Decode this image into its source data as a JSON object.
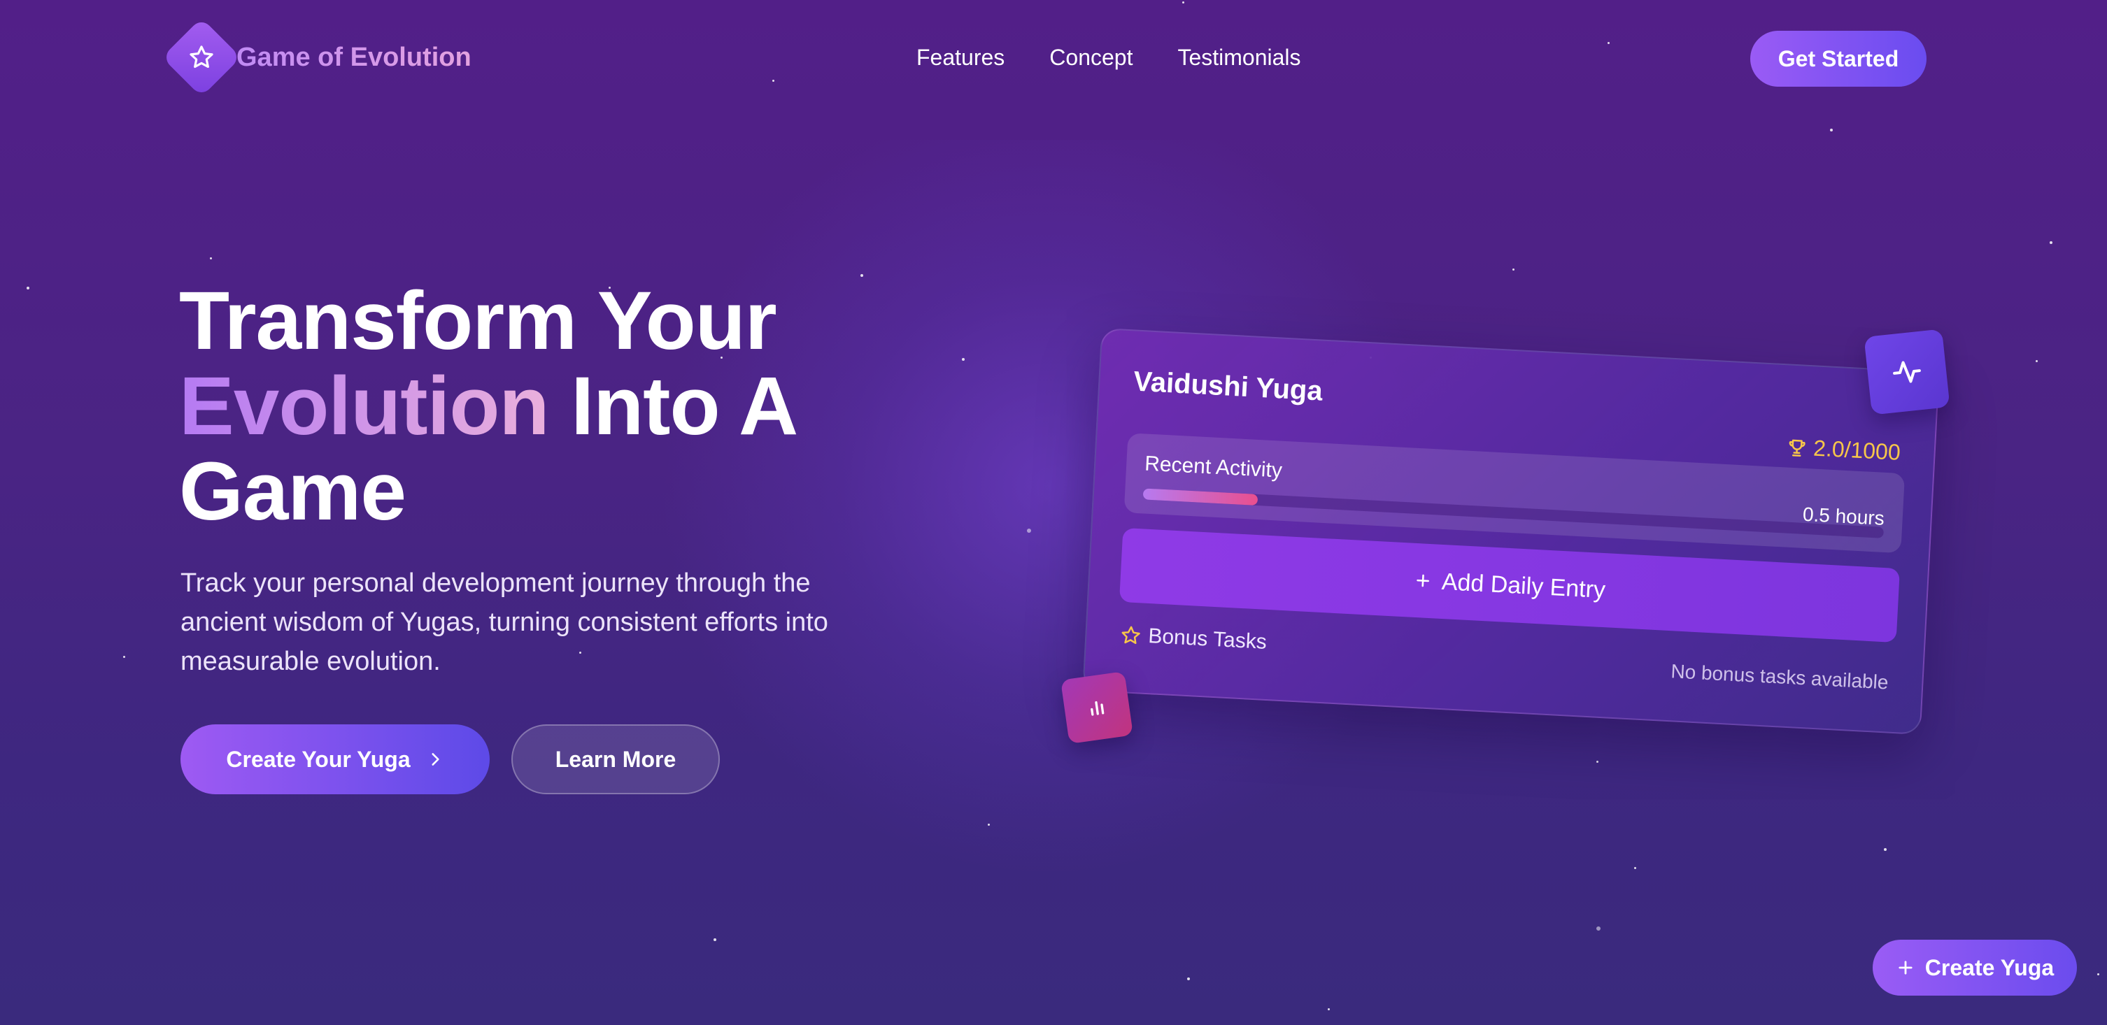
{
  "brand": {
    "name": "Game of Evolution",
    "logo_icon": "star-icon"
  },
  "nav": {
    "links": [
      {
        "label": "Features"
      },
      {
        "label": "Concept"
      },
      {
        "label": "Testimonials"
      }
    ],
    "cta_label": "Get Started"
  },
  "hero": {
    "title_line1": "Transform Your",
    "title_highlight": "Evolution",
    "title_line2_rest": " Into A",
    "title_line3": "Game",
    "description": "Track your personal development journey through the ancient wisdom of Yugas, turning consistent efforts into measurable evolution.",
    "primary_button": "Create Your Yuga",
    "secondary_button": "Learn More"
  },
  "card": {
    "title": "Vaidushi Yuga",
    "score": "2.0/1000",
    "recent_activity_label": "Recent Activity",
    "recent_activity_value": "0.5 hours",
    "progress_fraction": 0.155,
    "add_entry_label": "Add Daily Entry",
    "bonus_label": "Bonus Tasks",
    "bonus_empty": "No bonus tasks available"
  },
  "floating_button": {
    "label": "Create Yuga"
  },
  "colors": {
    "accent": "#9a5bf5",
    "score": "#f7c64a",
    "progress_end": "#e94f8e"
  }
}
